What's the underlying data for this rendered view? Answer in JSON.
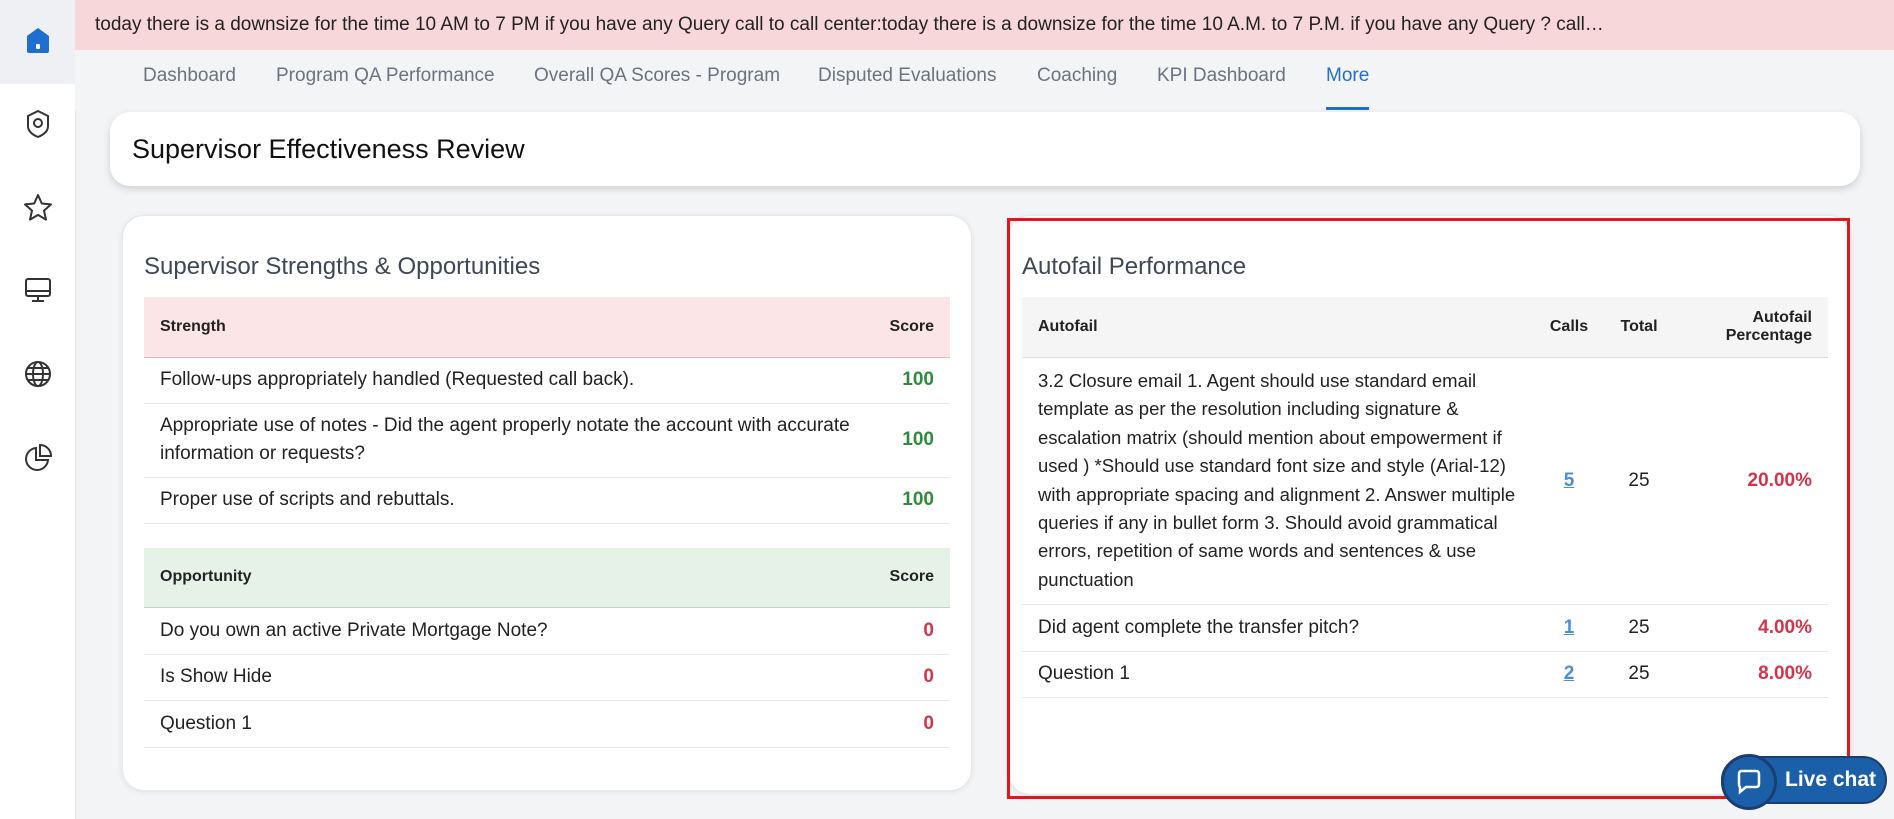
{
  "banner": {
    "text": "today there is a downsize for the time 10 AM to 7 PM if you have any Query call to call center:today there is a downsize for the time 10 A.M. to 7 P.M. if you have any Query ? call…"
  },
  "sidebar": {
    "items": [
      {
        "icon": "home-icon"
      },
      {
        "icon": "badge-icon"
      },
      {
        "icon": "star-icon"
      },
      {
        "icon": "monitor-icon"
      },
      {
        "icon": "globe-icon"
      },
      {
        "icon": "pie-chart-icon"
      }
    ],
    "accent": "#1e6fd0"
  },
  "tabs": [
    {
      "label": "Dashboard"
    },
    {
      "label": "Program QA Performance"
    },
    {
      "label": "Overall QA Scores - Program"
    },
    {
      "label": "Disputed Evaluations"
    },
    {
      "label": "Coaching"
    },
    {
      "label": "KPI Dashboard"
    },
    {
      "label": "More",
      "active": true
    }
  ],
  "page": {
    "title": "Supervisor Effectiveness Review"
  },
  "strengths_panel": {
    "title": "Supervisor Strengths & Opportunities",
    "strength_header": {
      "name": "Strength",
      "score": "Score"
    },
    "strengths": [
      {
        "name": "Follow-ups appropriately handled (Requested call back).",
        "score": "100"
      },
      {
        "name": "Appropriate use of notes - Did the agent properly notate the account with accurate information or requests?",
        "score": "100"
      },
      {
        "name": "Proper use of scripts and rebuttals.",
        "score": "100"
      }
    ],
    "opportunity_header": {
      "name": "Opportunity",
      "score": "Score"
    },
    "opportunities": [
      {
        "name": "Do you own an active Private Mortgage Note?",
        "score": "0"
      },
      {
        "name": "Is Show Hide",
        "score": "0"
      },
      {
        "name": "Question 1",
        "score": "0"
      }
    ]
  },
  "autofail_panel": {
    "title": "Autofail Performance",
    "headers": {
      "autofail": "Autofail",
      "calls": "Calls",
      "total": "Total",
      "percentage": "Autofail Percentage"
    },
    "rows": [
      {
        "autofail": "3.2 Closure email 1. Agent should use standard email template as per the resolution including signature & escalation matrix (should mention about empowerment if used ) *Should use standard font size and style (Arial-12) with appropriate spacing and alignment 2. Answer multiple queries if any in bullet form 3. Should avoid grammatical errors, repetition of same words and sentences & use punctuation",
        "calls": "5",
        "total": "25",
        "percentage": "20.00%"
      },
      {
        "autofail": "Did agent complete the transfer pitch?",
        "calls": "1",
        "total": "25",
        "percentage": "4.00%"
      },
      {
        "autofail": "Question 1",
        "calls": "2",
        "total": "25",
        "percentage": "8.00%"
      }
    ]
  },
  "live_chat": {
    "label": "Live chat"
  },
  "colors": {
    "banner_bg": "#f8d7da",
    "good": "#2e8b3a",
    "bad": "#d6334a",
    "link": "#4a90d9",
    "highlight": "#e3171b"
  }
}
